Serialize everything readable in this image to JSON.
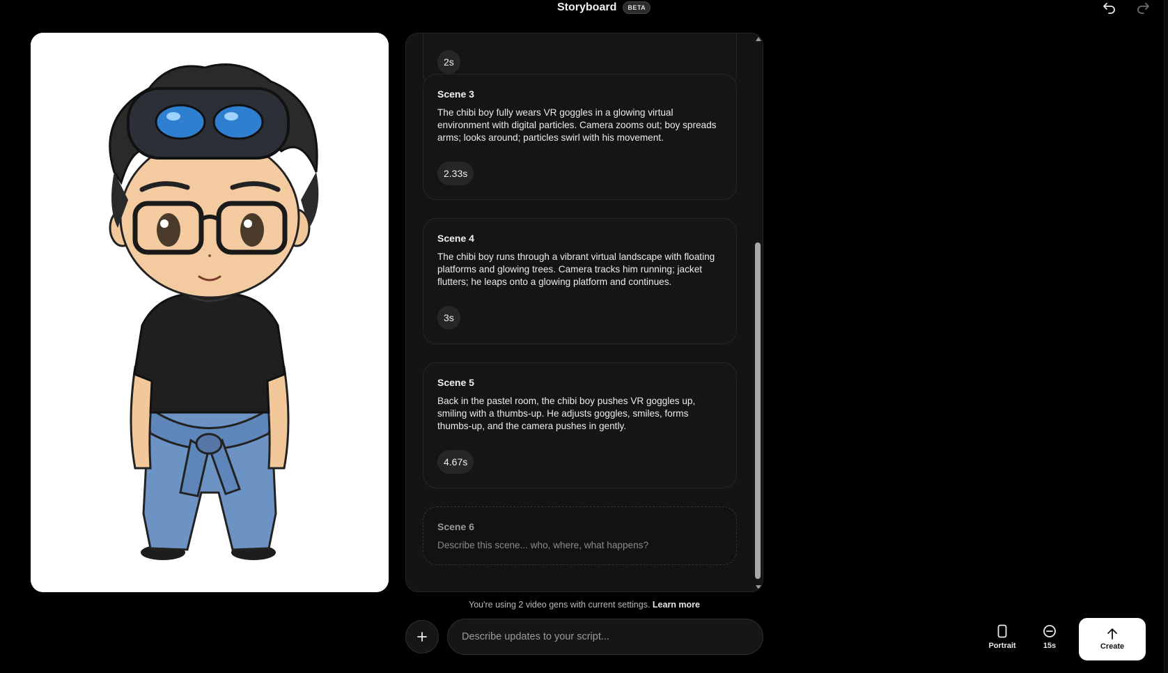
{
  "header": {
    "title": "Storyboard",
    "badge": "BETA"
  },
  "scenes": [
    {
      "title": "Scene 3",
      "description": "The chibi boy fully wears VR goggles in a glowing virtual environment with digital particles. Camera zooms out; boy spreads arms; looks around; particles swirl with his movement.",
      "duration": "2.33s"
    },
    {
      "title": "Scene 4",
      "description": "The chibi boy runs through a vibrant virtual landscape with floating platforms and glowing trees. Camera tracks him running; jacket flutters; he leaps onto a glowing platform and continues.",
      "duration": "3s"
    },
    {
      "title": "Scene 5",
      "description": "Back in the pastel room, the chibi boy pushes VR goggles up, smiling with a thumbs-up. He adjusts goggles, smiles, forms thumbs-up, and the camera pushes in gently.",
      "duration": "4.67s"
    }
  ],
  "new_scene": {
    "title": "Scene 6",
    "placeholder": "Describe this scene... who, where, what happens?"
  },
  "partial_chip": "2s",
  "usage": {
    "text": "You're using 2 video gens with current settings.",
    "link": "Learn more"
  },
  "composer": {
    "placeholder": "Describe updates to your script..."
  },
  "options": {
    "orientation": "Portrait",
    "duration": "15s",
    "create": "Create"
  }
}
